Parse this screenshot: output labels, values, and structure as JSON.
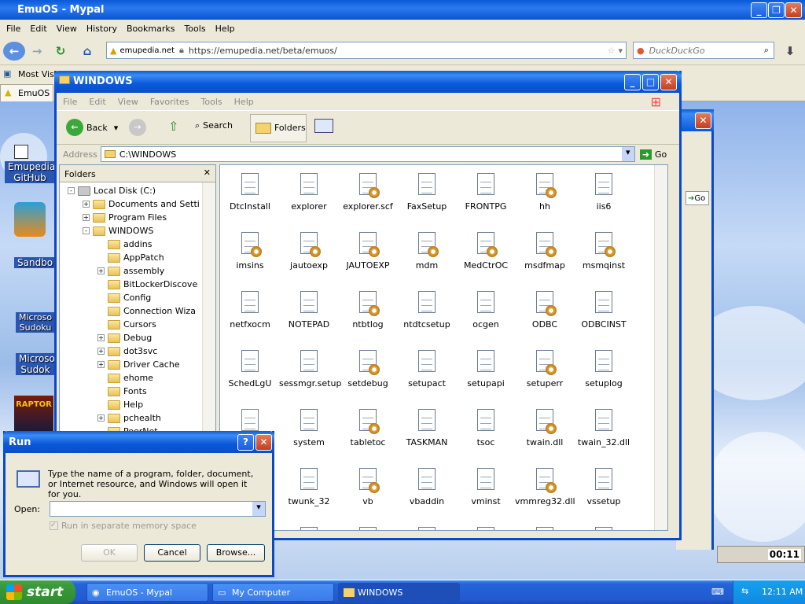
{
  "browser": {
    "title": "EmuOS - Mypal",
    "menu": [
      "File",
      "Edit",
      "View",
      "History",
      "Bookmarks",
      "Tools",
      "Help"
    ],
    "site_label": "emupedia.net",
    "url": "https://emupedia.net/beta/emuos/",
    "search_placeholder": "DuckDuckGo",
    "bookmarks_label": "Most Visi",
    "tab_label": "EmuOS"
  },
  "desktop": {
    "icons": [
      {
        "label": "Emupedia GitHub"
      },
      {
        "label": "Sandbo"
      },
      {
        "label": "Microso Sudoku"
      },
      {
        "label": "Microso Sudok"
      },
      {
        "label": "RAPTOR"
      }
    ],
    "back_window_go": "Go",
    "media_time": "00:11"
  },
  "explorer": {
    "title": "WINDOWS",
    "menu": [
      "File",
      "Edit",
      "View",
      "Favorites",
      "Tools",
      "Help"
    ],
    "back_label": "Back",
    "search_label": "Search",
    "folders_label": "Folders",
    "address_label": "Address",
    "address_value": "C:\\WINDOWS",
    "go_label": "Go",
    "folders_pane_title": "Folders",
    "tree": [
      {
        "label": "Local Disk (C:)",
        "level": 1,
        "exp": "-"
      },
      {
        "label": "Documents and Setti",
        "level": 2,
        "exp": "+"
      },
      {
        "label": "Program Files",
        "level": 2,
        "exp": "+"
      },
      {
        "label": "WINDOWS",
        "level": 2,
        "exp": "-"
      },
      {
        "label": "addins",
        "level": 3,
        "exp": ""
      },
      {
        "label": "AppPatch",
        "level": 3,
        "exp": ""
      },
      {
        "label": "assembly",
        "level": 3,
        "exp": "+"
      },
      {
        "label": "BitLockerDiscove",
        "level": 3,
        "exp": ""
      },
      {
        "label": "Config",
        "level": 3,
        "exp": ""
      },
      {
        "label": "Connection Wiza",
        "level": 3,
        "exp": ""
      },
      {
        "label": "Cursors",
        "level": 3,
        "exp": ""
      },
      {
        "label": "Debug",
        "level": 3,
        "exp": "+"
      },
      {
        "label": "dot3svc",
        "level": 3,
        "exp": "+"
      },
      {
        "label": "Driver Cache",
        "level": 3,
        "exp": "+"
      },
      {
        "label": "ehome",
        "level": 3,
        "exp": ""
      },
      {
        "label": "Fonts",
        "level": 3,
        "exp": ""
      },
      {
        "label": "Help",
        "level": 3,
        "exp": ""
      },
      {
        "label": "pchealth",
        "level": 3,
        "exp": "+"
      },
      {
        "label": "PeerNet",
        "level": 3,
        "exp": ""
      }
    ],
    "files": [
      [
        "DtcInstall",
        "explorer",
        "explorer.scf",
        "FaxSetup",
        "FRONTPG",
        "hh",
        "iis6"
      ],
      [
        "imsins",
        "jautoexp",
        "JAUTOEXP",
        "mdm",
        "MedCtrOC",
        "msdfmap",
        "msmqinst"
      ],
      [
        "netfxocm",
        "NOTEPAD",
        "ntbtlog",
        "ntdtcsetup",
        "ocgen",
        "ODBC",
        "ODBCINST"
      ],
      [
        "SchedLgU",
        "sessmgr.setup",
        "setdebug",
        "setupact",
        "setupapi",
        "setuperr",
        "setuplog"
      ],
      [
        "",
        "system",
        "tabletoc",
        "TASKMAN",
        "tsoc",
        "twain.dll",
        "twain_32.dll"
      ],
      [
        "",
        "twunk_32",
        "vb",
        "vbaddin",
        "vminst",
        "vmmreg32.dll",
        "vssetup"
      ],
      [
        "",
        "",
        "",
        "",
        "",
        "",
        ""
      ]
    ]
  },
  "run": {
    "title": "Run",
    "description": "Type the name of a program, folder, document, or Internet resource, and Windows will open it for you.",
    "open_label": "Open:",
    "open_value": "",
    "checkbox_label": "Run in separate memory space",
    "ok": "OK",
    "cancel": "Cancel",
    "browse": "Browse..."
  },
  "taskbar": {
    "start": "start",
    "tasks": [
      "EmuOS - Mypal",
      "My Computer",
      "WINDOWS"
    ],
    "clock": "12:11 AM"
  }
}
